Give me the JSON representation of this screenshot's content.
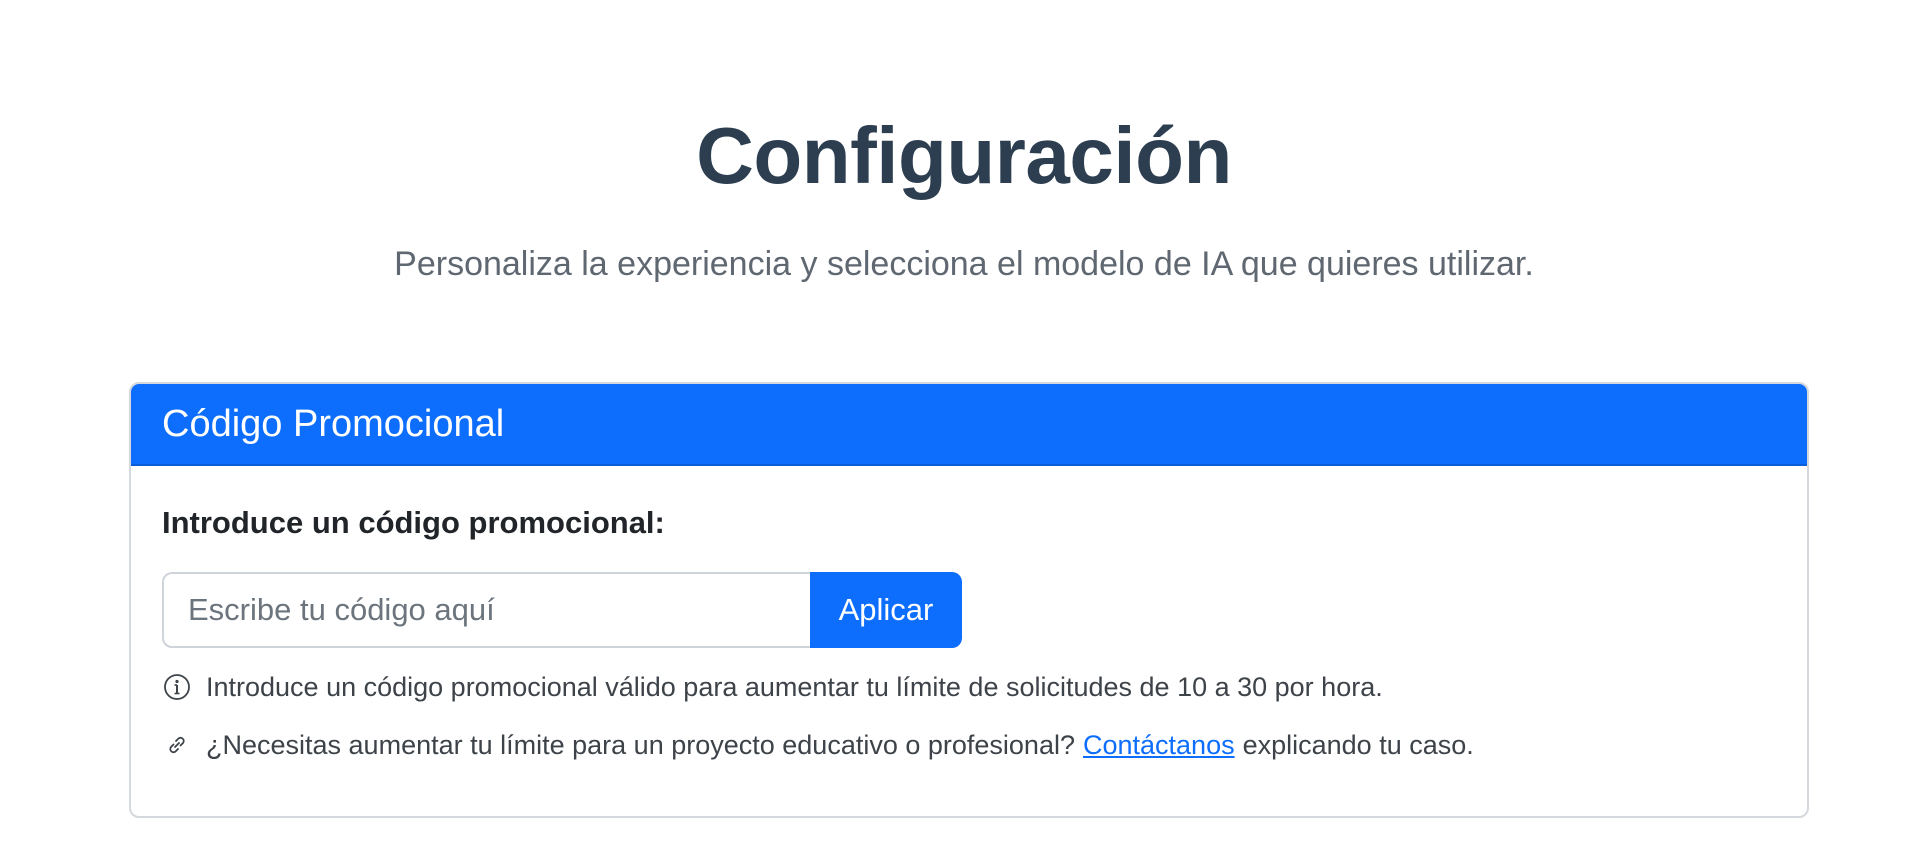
{
  "header": {
    "title": "Configuración",
    "subtitle": "Personaliza la experiencia y selecciona el modelo de IA que quieres utilizar."
  },
  "promo_card": {
    "title": "Código Promocional",
    "label": "Introduce un código promocional:",
    "input": {
      "value": "",
      "placeholder": "Escribe tu código aquí"
    },
    "apply_label": "Aplicar",
    "info_icon": "info-circle-icon",
    "info_text": "Introduce un código promocional válido para aumentar tu límite de solicitudes de 10 a 30 por hora.",
    "link_icon": "link-icon",
    "contact_prefix": "¿Necesitas aumentar tu límite para un proyecto educativo o profesional?",
    "contact_link": "Contáctanos",
    "contact_suffix": "explicando tu caso."
  },
  "colors": {
    "primary": "#0d6efd",
    "title": "#2c3e50",
    "muted": "#5f6771"
  }
}
